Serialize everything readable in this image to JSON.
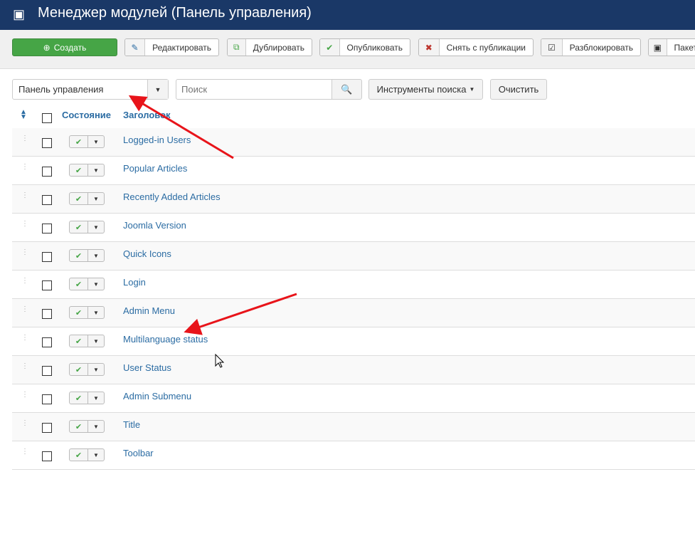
{
  "header": {
    "title": "Менеджер модулей (Панель управления)",
    "icon": "cube-icon"
  },
  "toolbar": {
    "create": "Создать",
    "edit": "Редактировать",
    "duplicate": "Дублировать",
    "publish": "Опубликовать",
    "unpublish": "Снять с публикации",
    "checkin": "Разблокировать",
    "batch": "Пакет"
  },
  "filters": {
    "client": "Панель управления",
    "search_placeholder": "Поиск",
    "search_tools": "Инструменты поиска",
    "clear": "Очистить"
  },
  "table": {
    "col_status": "Состояние",
    "col_title": "Заголовок",
    "rows": [
      {
        "title": "Logged-in Users"
      },
      {
        "title": "Popular Articles"
      },
      {
        "title": "Recently Added Articles"
      },
      {
        "title": "Joomla Version"
      },
      {
        "title": "Quick Icons"
      },
      {
        "title": "Login"
      },
      {
        "title": "Admin Menu"
      },
      {
        "title": "Multilanguage status"
      },
      {
        "title": "User Status"
      },
      {
        "title": "Admin Submenu"
      },
      {
        "title": "Title"
      },
      {
        "title": "Toolbar"
      }
    ]
  }
}
